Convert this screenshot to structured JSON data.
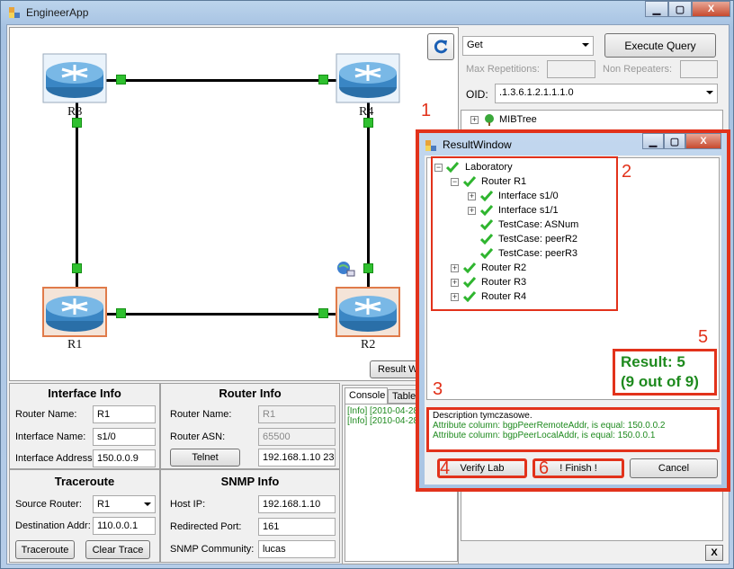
{
  "app": {
    "title": "EngineerApp",
    "min": "▁",
    "max": "▢",
    "close": "X"
  },
  "topology": {
    "routers": [
      {
        "label": "R3"
      },
      {
        "label": "R4"
      },
      {
        "label": "R1"
      },
      {
        "label": "R2"
      }
    ],
    "result_button": "Result Wi"
  },
  "snmp_query": {
    "operation": "Get",
    "execute_label": "Execute Query",
    "max_rep_label": "Max Repetitions:",
    "non_rep_label": "Non Repeaters:",
    "oid_label": "OID:",
    "oid_value": ".1.3.6.1.2.1.1.1.0",
    "mibtree_label": "MIBTree"
  },
  "interface_info": {
    "title": "Interface Info",
    "router_name_label": "Router Name:",
    "router_name": "R1",
    "interface_name_label": "Interface Name:",
    "interface_name": "s1/0",
    "interface_address_label": "Interface Address:",
    "interface_address": "150.0.0.9"
  },
  "router_info": {
    "title": "Router Info",
    "router_name_label": "Router Name:",
    "router_name": "R1",
    "router_asn_label": "Router ASN:",
    "router_asn": "65500",
    "telnet_label": "Telnet",
    "telnet_addr": "192.168.1.10 23"
  },
  "traceroute": {
    "title": "Traceroute",
    "source_label": "Source Router:",
    "source_value": "R1",
    "dest_label": "Destination Addr:",
    "dest_value": "110.0.0.1",
    "traceroute_btn": "Traceroute",
    "clear_btn": "Clear Trace"
  },
  "snmp_info": {
    "title": "SNMP Info",
    "host_ip_label": "Host IP:",
    "host_ip": "192.168.1.10",
    "port_label": "Redirected Port:",
    "port": "161",
    "community_label": "SNMP Community:",
    "community": "lucas"
  },
  "console": {
    "tabs": [
      "Console",
      "Table"
    ],
    "lines": [
      "[Info] [2010-04-28",
      "[Info] [2010-04-28"
    ]
  },
  "result_window": {
    "title": "ResultWindow",
    "tree": [
      "Laboratory",
      "Router R1",
      "Interface s1/0",
      "Interface s1/1",
      "TestCase: ASNum",
      "TestCase: peerR2",
      "TestCase: peerR3",
      "Router R2",
      "Router R3",
      "Router R4"
    ],
    "result_line1": "Result: 5",
    "result_line2": "(9 out of 9)",
    "desc_title": "Description tymczasowe.",
    "desc_lines": [
      "Attribute column: bgpPeerRemoteAddr, is equal: 150.0.0.2",
      "Attribute column: bgpPeerLocalAddr, is equal: 150.0.0.1"
    ],
    "verify_btn": "Verify Lab",
    "finish_btn": "! Finish !",
    "cancel_btn": "Cancel"
  },
  "annotations": [
    "1",
    "2",
    "3",
    "4",
    "5",
    "6"
  ],
  "close_small": "X",
  "colors": {
    "accent_red": "#e2321b",
    "ok_green": "#2fc02f",
    "result_green": "#1e8a1e"
  }
}
